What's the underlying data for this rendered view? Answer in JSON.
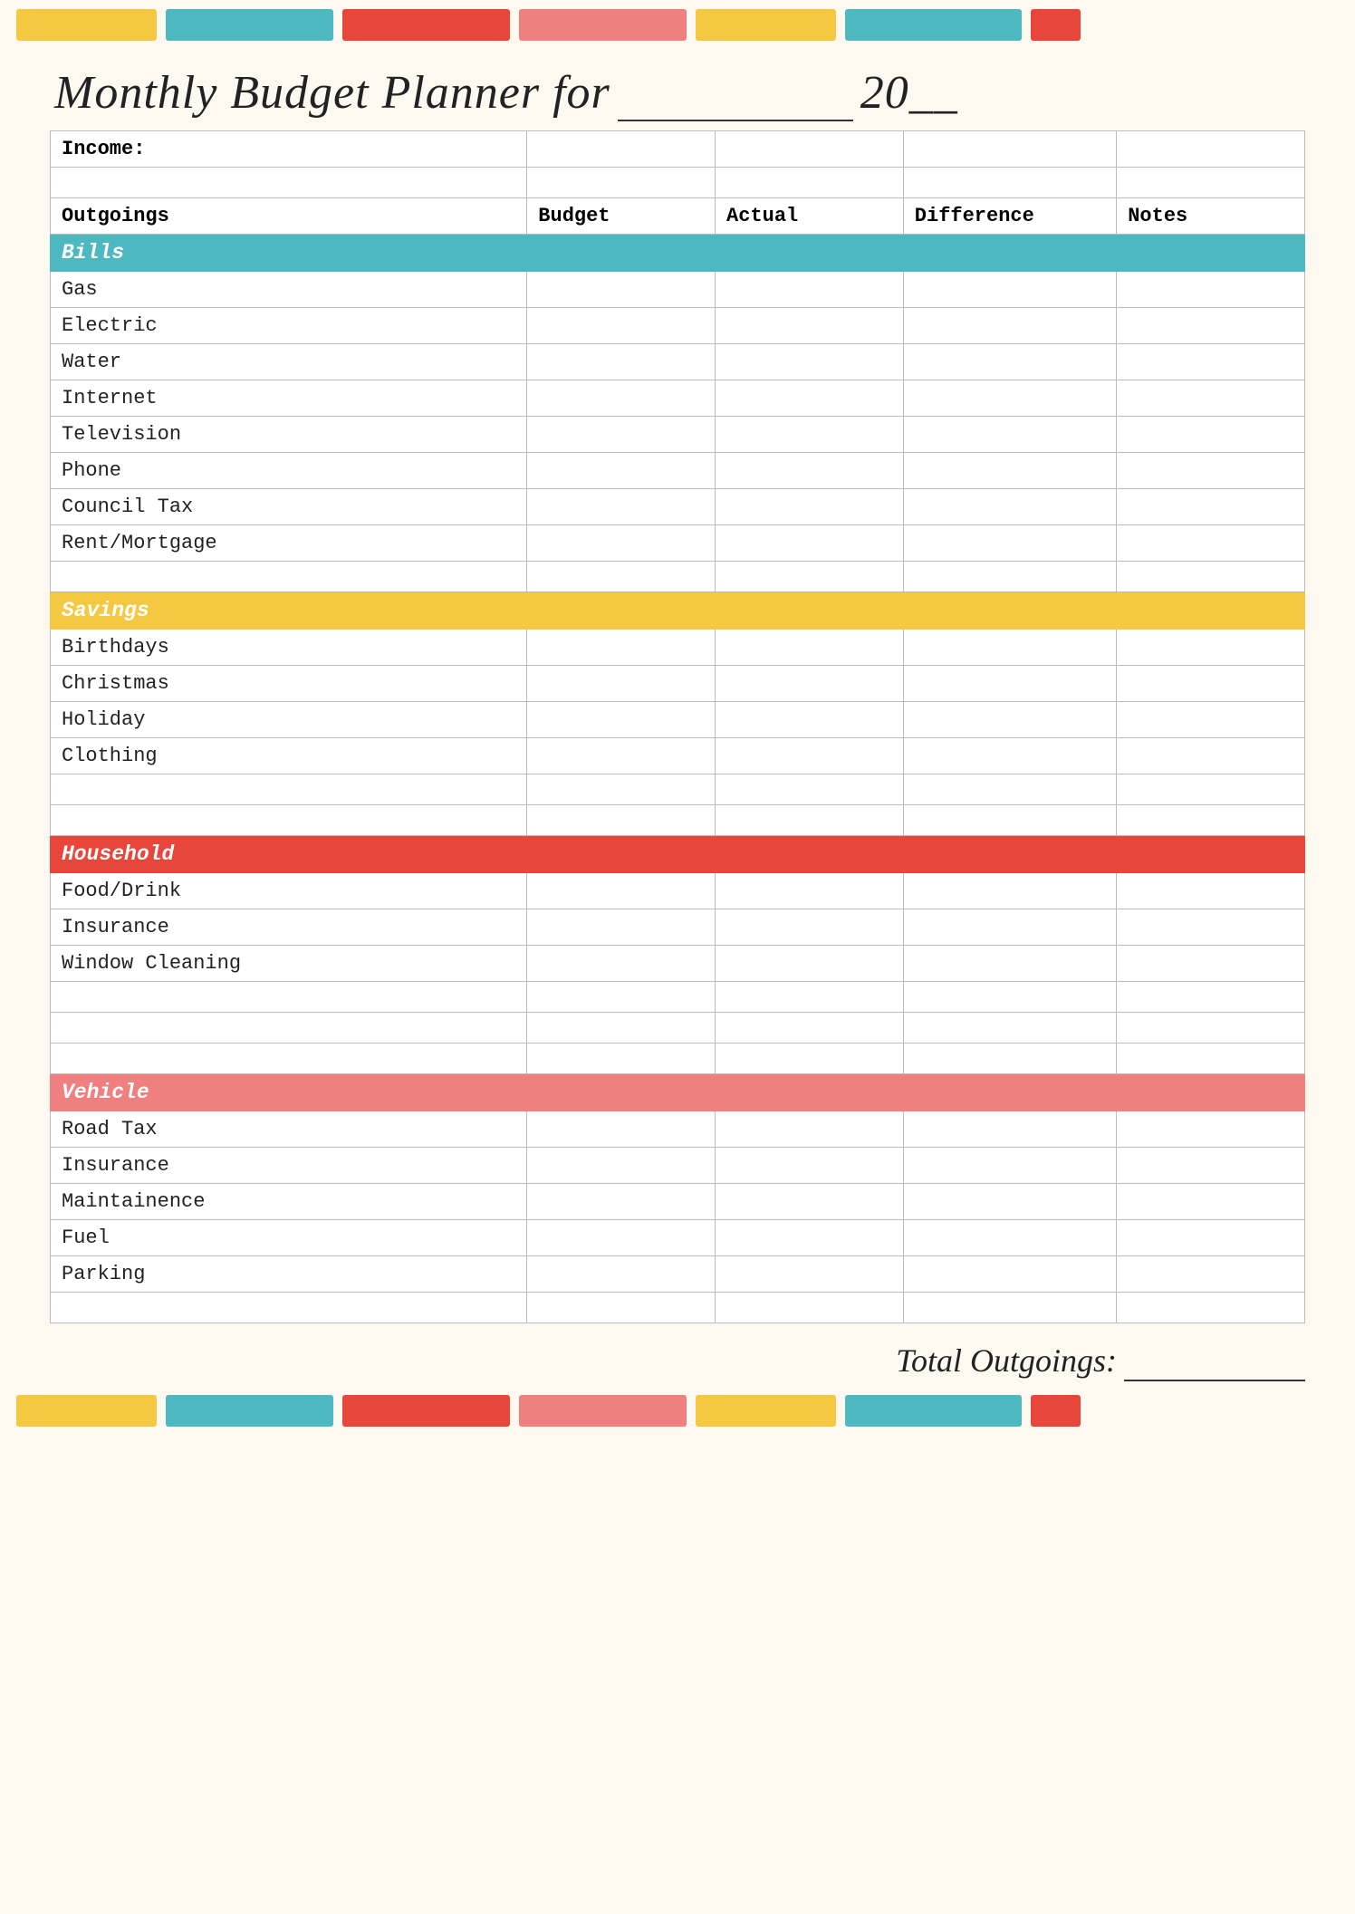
{
  "title": {
    "line1": "Monthly Budget Planner for",
    "year_prefix": "20",
    "year_blank": "__"
  },
  "table": {
    "income_label": "Income:",
    "headers": {
      "outgoings": "Outgoings",
      "budget": "Budget",
      "actual": "Actual",
      "difference": "Difference",
      "notes": "Notes"
    },
    "sections": {
      "bills": {
        "label": "Bills",
        "rows": [
          "Gas",
          "Electric",
          "Water",
          "Internet",
          "Television",
          "Phone",
          "Council Tax",
          "Rent/Mortgage"
        ]
      },
      "savings": {
        "label": "Savings",
        "rows": [
          "Birthdays",
          "Christmas",
          "Holiday",
          "Clothing"
        ]
      },
      "household": {
        "label": "Household",
        "rows": [
          "Food/Drink",
          "Insurance",
          "Window Cleaning"
        ]
      },
      "vehicle": {
        "label": "Vehicle",
        "rows": [
          "Road Tax",
          "Insurance",
          "Maintainence",
          "Fuel",
          "Parking"
        ]
      }
    }
  },
  "total": {
    "label": "Total Outgoings:",
    "blank": "_______"
  },
  "color_swatches": [
    {
      "color": "#f5c842",
      "class": "sw-yellow sw-1"
    },
    {
      "color": "#4db8c0",
      "class": "sw-teal sw-2"
    },
    {
      "color": "#e8463a",
      "class": "sw-red sw-3"
    },
    {
      "color": "#f08080",
      "class": "sw-pink sw-4"
    },
    {
      "color": "#f5c842",
      "class": "sw-yellow2 sw-5"
    },
    {
      "color": "#4db8c0",
      "class": "sw-teal2 sw-6"
    },
    {
      "color": "#e8463a",
      "class": "sw-red2 sw-7"
    }
  ]
}
